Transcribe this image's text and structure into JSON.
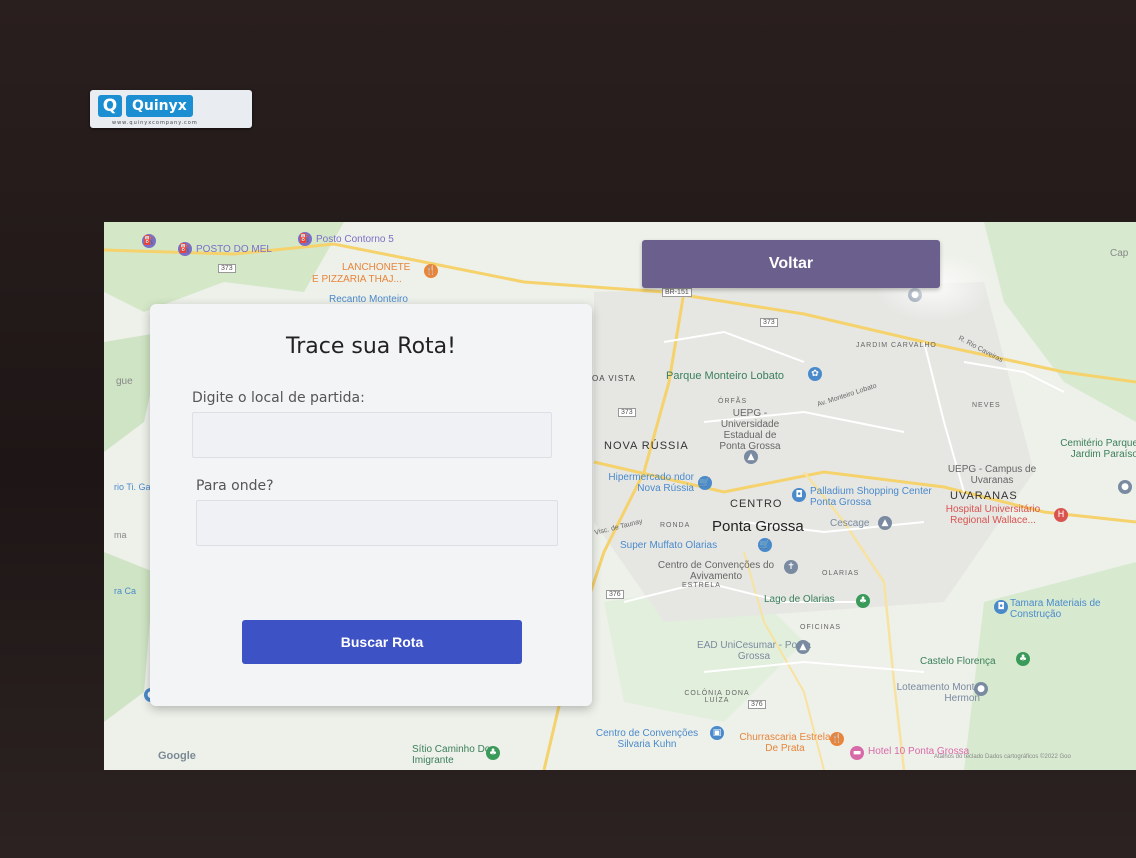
{
  "device": {
    "logo_mark": "Q",
    "logo_text": "Quinyx",
    "logo_subtext": "www.quinyxcompany.com"
  },
  "nav": {
    "back_label": "Voltar"
  },
  "route_form": {
    "title": "Trace sua Rota!",
    "origin_label": "Digite o local de partida:",
    "origin_value": "",
    "destination_label": "Para onde?",
    "destination_value": "",
    "search_label": "Buscar Rota"
  },
  "map": {
    "labels": {
      "posto_do_mel": "POSTO DO MEL",
      "posto_contorno": "Posto Contorno 5",
      "lanchonete": "LANCHONETE",
      "pizzaria": "E PIZZARIA THAJ...",
      "recanto": "Recanto Monteiro",
      "jardim_carvalho": "JARDIM CARVALHO",
      "rio_caveiras": "R. Rio Caveiras",
      "boa_vista": "OA VISTA",
      "parque": "Parque Monteiro Lobato",
      "av_monteiro": "Av. Monteiro Lobato",
      "orfas": "ÓRFÃS",
      "neves": "NEVES",
      "uepg": "UEPG - Universidade Estadual de Ponta Grossa",
      "nova_russia": "NOVA RÚSSIA",
      "cemiterio": "Cemitério Parque Jardim Paraíso",
      "uepg_campus": "UEPG - Campus de Uvaranas",
      "hipermercado": "Hipermercado ndor Nova Rússia",
      "centro": "CENTRO",
      "palladium": "Palladium Shopping Center Ponta Grossa",
      "uvaranas": "UVARANAS",
      "hospital": "Hospital Universitário Regional Wallace...",
      "ponta_grossa": "Ponta Grossa",
      "cescage": "Cescage",
      "ronda": "RONDA",
      "visc": "Visc. de Taunay",
      "super_muffato": "Super Muffato Olarias",
      "centro_conv": "Centro de Convenções do Avivamento",
      "olarias": "OLARIAS",
      "estrela": "ESTRELA",
      "lago": "Lago de Olarias",
      "tamara": "Tamara Materiais de Construção",
      "oficinas": "OFICINAS",
      "ead": "EAD UniCesumar - Ponta Grossa",
      "castelo": "Castelo Florença",
      "loteamento": "Loteamento Monte Hermon",
      "colonia": "COLÔNIA DONA LUÍZA",
      "centro_silvaria": "Centro de Convenções Silvaria Kuhn",
      "churrascaria": "Churrascaria Estrela De Prata",
      "hotel": "Hotel 10 Ponta Grossa",
      "sitio": "Sítio Caminho Do Imigrante",
      "google": "Google",
      "attribution": "Atalhos do teclado   Dados cartográficos ©2022 Goo",
      "road_373a": "373",
      "road_373b": "373",
      "road_373c": "373",
      "road_376": "376",
      "road_br151": "BR-151",
      "road_376b": "376",
      "cap": "Cap",
      "gue": "gue",
      "rio": "rio Ti. Ga P",
      "ma": "ma",
      "ra": "ra Ca"
    }
  },
  "colors": {
    "button_primary": "#3d52c4",
    "button_back": "#6b5f8e",
    "map_bg": "#eef0ea",
    "road_major": "#f5d26b",
    "park": "#c9e6c1"
  }
}
